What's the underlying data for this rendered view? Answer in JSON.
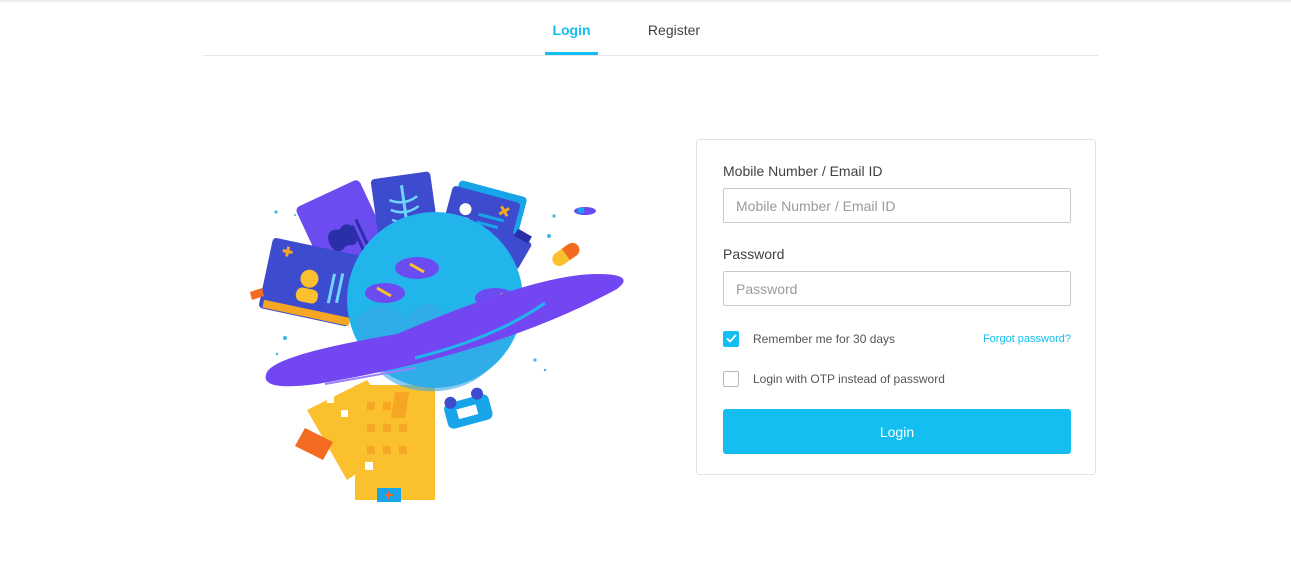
{
  "tabs": {
    "login": "Login",
    "register": "Register",
    "active": "login"
  },
  "form": {
    "mobile_label": "Mobile Number / Email ID",
    "mobile_placeholder": "Mobile Number / Email ID",
    "mobile_value": "",
    "password_label": "Password",
    "password_placeholder": "Password",
    "password_value": "",
    "remember_label": "Remember me for 30 days",
    "remember_checked": true,
    "forgot_label": "Forgot password?",
    "otp_label": "Login with OTP instead of password",
    "otp_checked": false,
    "login_button": "Login"
  },
  "colors": {
    "accent": "#14bef0",
    "text": "#414146"
  },
  "icons": {
    "remember_check": "checkmark-icon"
  }
}
